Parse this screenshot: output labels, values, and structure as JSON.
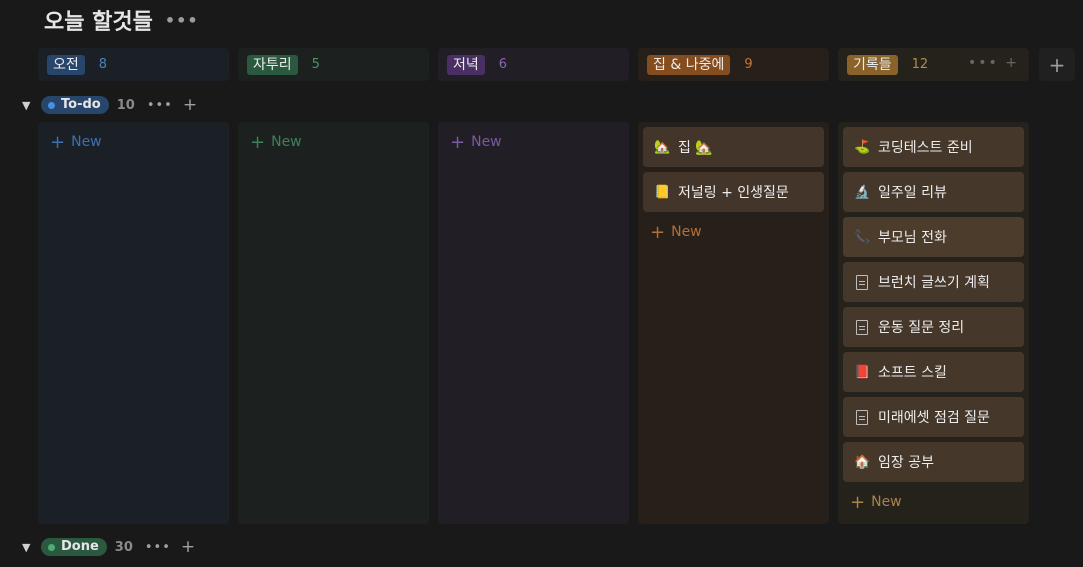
{
  "page": {
    "title": "오늘 할것들",
    "title_menu_icon": "ellipsis-icon"
  },
  "columns": [
    {
      "label": "오전",
      "count": "8",
      "chip_bg": "#28456c",
      "count_color": "#4d7fc2",
      "bg": "#1b2027"
    },
    {
      "label": "자투리",
      "count": "5",
      "chip_bg": "#2b593f",
      "count_color": "#4a9367",
      "bg": "#1c211f"
    },
    {
      "label": "저녁",
      "count": "6",
      "chip_bg": "#492f64",
      "count_color": "#8a67b3",
      "bg": "#211e26"
    },
    {
      "label": "집 & 나중에",
      "count": "9",
      "chip_bg": "#854c1d",
      "count_color": "#c17a3e",
      "bg": "#261f1a"
    },
    {
      "label": "기록들",
      "count": "12",
      "chip_bg": "#89632a",
      "count_color": "#b08c50",
      "bg": "#25221c"
    }
  ],
  "groups": {
    "todo": {
      "label": "To-do",
      "count": "10",
      "pill_bg": "#28456c",
      "dot": "#4a90e2"
    },
    "done": {
      "label": "Done",
      "count": "30",
      "pill_bg": "#2b593f",
      "dot": "#4caf72"
    }
  },
  "new_label": "New",
  "cards": {
    "home_later": [
      {
        "icon": "🏡",
        "title": "집 🏡"
      },
      {
        "icon": "📒",
        "title": "저널링 + 인생질문"
      }
    ],
    "records": [
      {
        "icon": "⛳",
        "title": "코딩테스트 준비"
      },
      {
        "icon": "🔬",
        "title": "일주일 리뷰"
      },
      {
        "icon": "📞",
        "title": "부모님 전화"
      },
      {
        "icon": "doc",
        "title": "브런치 글쓰기 계획"
      },
      {
        "icon": "doc",
        "title": "운동 질문 정리"
      },
      {
        "icon": "📕",
        "title": "소프트 스킬"
      },
      {
        "icon": "doc",
        "title": "미래에셋 점검 질문"
      },
      {
        "icon": "🏠",
        "title": "임장 공부"
      }
    ]
  },
  "colors": {
    "card_home": "#44352a",
    "card_records": "#45382a",
    "new_todo": "#3d6fb0",
    "new_break": "#3e8058",
    "new_evening": "#7a5aa0",
    "new_home": "#b36f38",
    "new_records": "#a88348"
  }
}
